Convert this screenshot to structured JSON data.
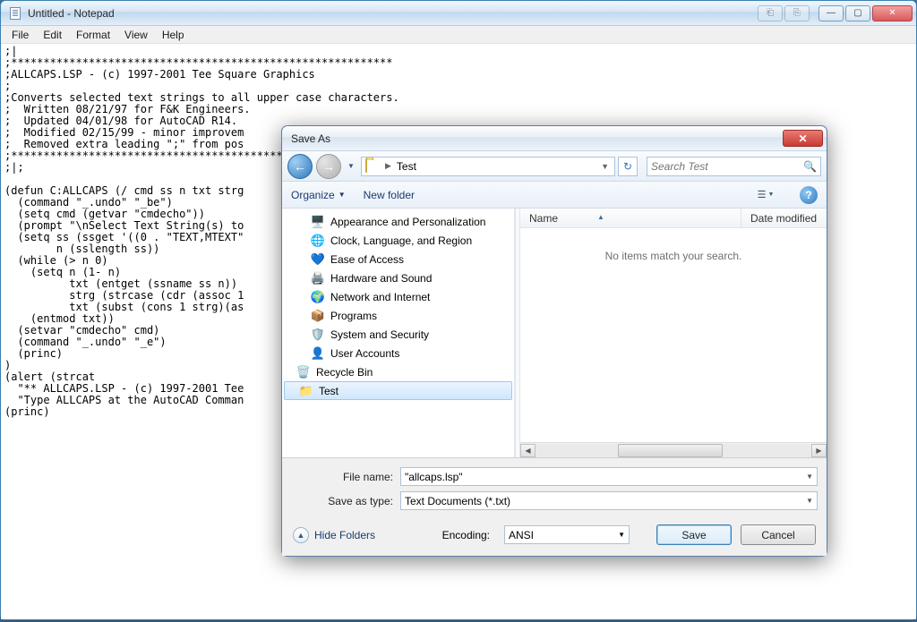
{
  "notepad": {
    "title": "Untitled - Notepad",
    "menu": {
      "file": "File",
      "edit": "Edit",
      "format": "Format",
      "view": "View",
      "help": "Help"
    },
    "content": ";|\n;***********************************************************\n;ALLCAPS.LSP - (c) 1997-2001 Tee Square Graphics\n;\n;Converts selected text strings to all upper case characters.\n;  Written 08/21/97 for F&K Engineers.\n;  Updated 04/01/98 for AutoCAD R14.\n;  Modified 02/15/99 - minor improvem\n;  Removed extra leading \";\" from pos\n;******************************************\n;|;\n\n(defun C:ALLCAPS (/ cmd ss n txt strg\n  (command \"_.undo\" \"_be\")\n  (setq cmd (getvar \"cmdecho\"))\n  (prompt \"\\nSelect Text String(s) to\n  (setq ss (ssget '((0 . \"TEXT,MTEXT\"\n        n (sslength ss))\n  (while (> n 0)\n    (setq n (1- n)\n          txt (entget (ssname ss n))\n          strg (strcase (cdr (assoc 1\n          txt (subst (cons 1 strg)(as\n    (entmod txt))\n  (setvar \"cmdecho\" cmd)\n  (command \"_.undo\" \"_e\")\n  (princ)\n)\n(alert (strcat\n  \"** ALLCAPS.LSP - (c) 1997-2001 Tee\n  \"Type ALLCAPS at the AutoCAD Comman\n(princ)"
  },
  "dialog": {
    "title": "Save As",
    "breadcrumb": {
      "segment": "Test"
    },
    "search": {
      "placeholder": "Search Test"
    },
    "toolbar": {
      "organize": "Organize",
      "newfolder": "New folder"
    },
    "navitems": [
      {
        "label": "Appearance and Personalization",
        "icon": "🖥️"
      },
      {
        "label": "Clock, Language, and Region",
        "icon": "🌐"
      },
      {
        "label": "Ease of Access",
        "icon": "💙"
      },
      {
        "label": "Hardware and Sound",
        "icon": "🖨️"
      },
      {
        "label": "Network and Internet",
        "icon": "🌍"
      },
      {
        "label": "Programs",
        "icon": "📦"
      },
      {
        "label": "System and Security",
        "icon": "🛡️"
      },
      {
        "label": "User Accounts",
        "icon": "👤"
      },
      {
        "label": "Recycle Bin",
        "icon": "🗑️"
      },
      {
        "label": "Test",
        "icon": "📁",
        "selected": true
      }
    ],
    "columns": {
      "name": "Name",
      "date": "Date modified"
    },
    "empty_msg": "No items match your search.",
    "filename_label": "File name:",
    "filename_value": "\"allcaps.lsp\"",
    "savetype_label": "Save as type:",
    "savetype_value": "Text Documents (*.txt)",
    "encoding_label": "Encoding:",
    "encoding_value": "ANSI",
    "hide_folders": "Hide Folders",
    "save_btn": "Save",
    "cancel_btn": "Cancel"
  }
}
